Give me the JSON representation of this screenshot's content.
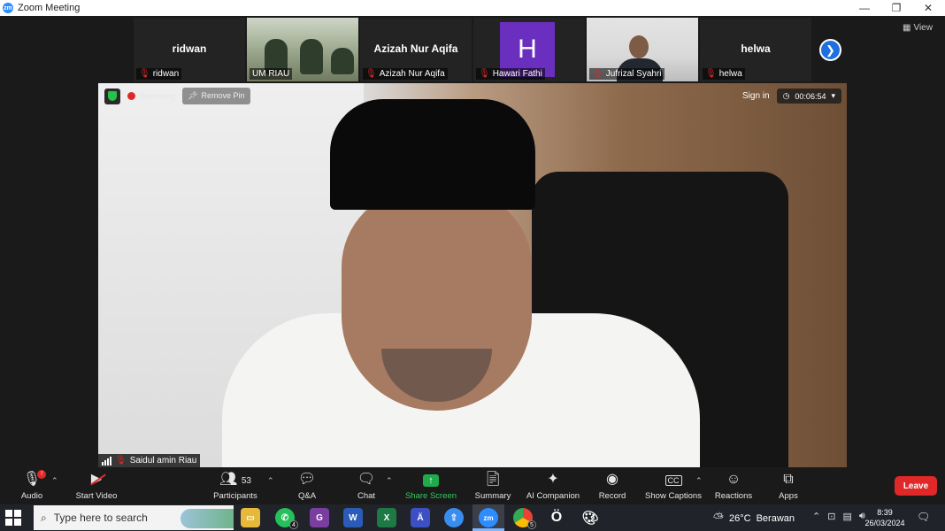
{
  "window": {
    "title": "Zoom Meeting",
    "controls": [
      "—",
      "❐",
      "✕"
    ]
  },
  "participants_strip": [
    {
      "type": "name",
      "display": "ridwan",
      "label": "ridwan",
      "muted": true
    },
    {
      "type": "video",
      "display": "",
      "label": "UM RIAU",
      "muted": false
    },
    {
      "type": "name",
      "display": "Azizah Nur Aqifa",
      "label": "Azizah Nur Aqifa",
      "muted": true
    },
    {
      "type": "avatar",
      "display": "H",
      "label": "Hawari Fathi",
      "muted": true,
      "avatar_color": "#6a2fbf"
    },
    {
      "type": "video",
      "display": "",
      "label": "Jufrizal Syahri",
      "muted": true
    },
    {
      "type": "name",
      "display": "helwa",
      "label": "helwa",
      "muted": true
    }
  ],
  "view_label": "View",
  "main_video": {
    "recording_label": "Recording",
    "remove_pin_label": "Remove Pin",
    "sign_in_label": "Sign in",
    "timer": "00:06:54",
    "speaker_name": "Saidul amin Riau"
  },
  "toolbar": {
    "audio": "Audio",
    "start_video": "Start Video",
    "participants": "Participants",
    "participants_count": "53",
    "qa": "Q&A",
    "chat": "Chat",
    "share_screen": "Share Screen",
    "summary": "Summary",
    "ai_companion": "AI Companion",
    "record": "Record",
    "show_captions": "Show Captions",
    "reactions": "Reactions",
    "apps": "Apps",
    "leave": "Leave",
    "audio_badge": "!"
  },
  "taskbar": {
    "search_placeholder": "Type here to search",
    "whatsapp_count": "4",
    "chrome_count": "5",
    "weather_temp": "26°C",
    "weather_desc": "Berawan",
    "time": "8:39",
    "date": "26/03/2024"
  },
  "colors": {
    "accent": "#2d8cff",
    "leave": "#e02828",
    "share": "#1faa4b"
  }
}
